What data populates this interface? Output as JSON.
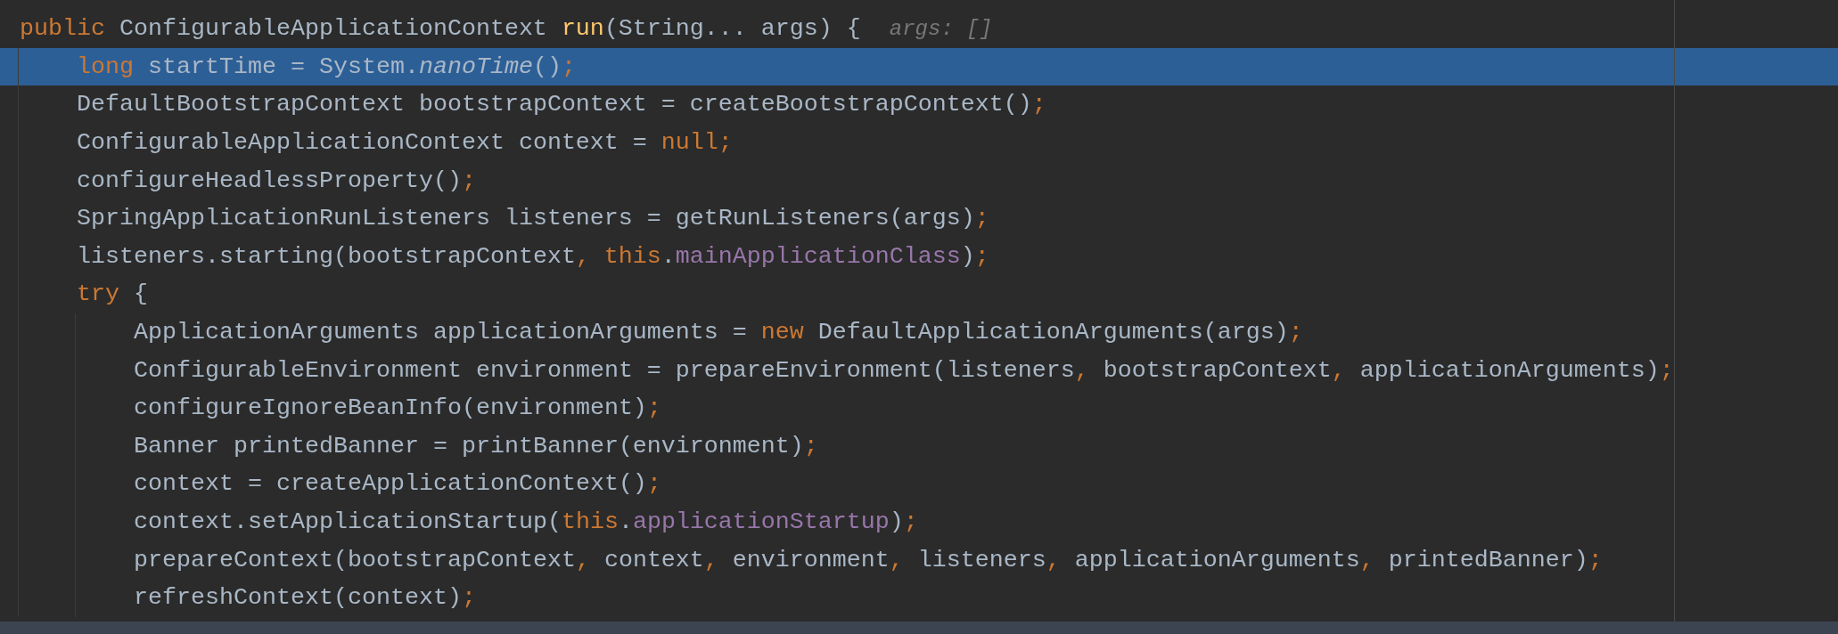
{
  "editor": {
    "lines": [
      {
        "selected": false,
        "tokens": [
          {
            "kind": "keyword",
            "text": "public"
          },
          {
            "kind": "plain",
            "text": " ConfigurableApplicationContext "
          },
          {
            "kind": "declaration",
            "text": "run"
          },
          {
            "kind": "plain",
            "text": "(String... args) {"
          }
        ],
        "hint": "args: []",
        "children": [
          {
            "selected": true,
            "tokens": [
              {
                "kind": "keyword",
                "text": "long"
              },
              {
                "kind": "plain",
                "text": " startTime = System."
              },
              {
                "kind": "static",
                "text": "nanoTime"
              },
              {
                "kind": "plain",
                "text": "()"
              },
              {
                "kind": "punct",
                "text": ";"
              }
            ]
          },
          {
            "selected": false,
            "tokens": [
              {
                "kind": "plain",
                "text": "DefaultBootstrapContext bootstrapContext = createBootstrapContext()"
              },
              {
                "kind": "punct",
                "text": ";"
              }
            ]
          },
          {
            "selected": false,
            "tokens": [
              {
                "kind": "plain",
                "text": "ConfigurableApplicationContext context = "
              },
              {
                "kind": "keyword",
                "text": "null"
              },
              {
                "kind": "punct",
                "text": ";"
              }
            ]
          },
          {
            "selected": false,
            "tokens": [
              {
                "kind": "plain",
                "text": "configureHeadlessProperty()"
              },
              {
                "kind": "punct",
                "text": ";"
              }
            ]
          },
          {
            "selected": false,
            "tokens": [
              {
                "kind": "plain",
                "text": "SpringApplicationRunListeners listeners = getRunListeners(args)"
              },
              {
                "kind": "punct",
                "text": ";"
              }
            ]
          },
          {
            "selected": false,
            "tokens": [
              {
                "kind": "plain",
                "text": "listeners.starting(bootstrapContext"
              },
              {
                "kind": "punct",
                "text": ","
              },
              {
                "kind": "keyword",
                "text": " this"
              },
              {
                "kind": "plain",
                "text": "."
              },
              {
                "kind": "field",
                "text": "mainApplicationClass"
              },
              {
                "kind": "plain",
                "text": ")"
              },
              {
                "kind": "punct",
                "text": ";"
              }
            ]
          },
          {
            "selected": false,
            "tokens": [
              {
                "kind": "keyword",
                "text": "try"
              },
              {
                "kind": "plain",
                "text": " {"
              }
            ],
            "children": [
              {
                "selected": false,
                "tokens": [
                  {
                    "kind": "plain",
                    "text": "ApplicationArguments applicationArguments = "
                  },
                  {
                    "kind": "keyword",
                    "text": "new"
                  },
                  {
                    "kind": "plain",
                    "text": " DefaultApplicationArguments(args)"
                  },
                  {
                    "kind": "punct",
                    "text": ";"
                  }
                ]
              },
              {
                "selected": false,
                "tokens": [
                  {
                    "kind": "plain",
                    "text": "ConfigurableEnvironment environment = prepareEnvironment(listeners"
                  },
                  {
                    "kind": "punct",
                    "text": ","
                  },
                  {
                    "kind": "plain",
                    "text": " bootstrapContext"
                  },
                  {
                    "kind": "punct",
                    "text": ","
                  },
                  {
                    "kind": "plain",
                    "text": " applicationArguments)"
                  },
                  {
                    "kind": "punct",
                    "text": ";"
                  }
                ]
              },
              {
                "selected": false,
                "tokens": [
                  {
                    "kind": "plain",
                    "text": "configureIgnoreBeanInfo(environment)"
                  },
                  {
                    "kind": "punct",
                    "text": ";"
                  }
                ]
              },
              {
                "selected": false,
                "tokens": [
                  {
                    "kind": "plain",
                    "text": "Banner printedBanner = printBanner(environment)"
                  },
                  {
                    "kind": "punct",
                    "text": ";"
                  }
                ]
              },
              {
                "selected": false,
                "tokens": [
                  {
                    "kind": "plain",
                    "text": "context = createApplicationContext()"
                  },
                  {
                    "kind": "punct",
                    "text": ";"
                  }
                ]
              },
              {
                "selected": false,
                "tokens": [
                  {
                    "kind": "plain",
                    "text": "context.setApplicationStartup("
                  },
                  {
                    "kind": "keyword",
                    "text": "this"
                  },
                  {
                    "kind": "plain",
                    "text": "."
                  },
                  {
                    "kind": "field",
                    "text": "applicationStartup"
                  },
                  {
                    "kind": "plain",
                    "text": ")"
                  },
                  {
                    "kind": "punct",
                    "text": ";"
                  }
                ]
              },
              {
                "selected": false,
                "tokens": [
                  {
                    "kind": "plain",
                    "text": "prepareContext(bootstrapContext"
                  },
                  {
                    "kind": "punct",
                    "text": ","
                  },
                  {
                    "kind": "plain",
                    "text": " context"
                  },
                  {
                    "kind": "punct",
                    "text": ","
                  },
                  {
                    "kind": "plain",
                    "text": " environment"
                  },
                  {
                    "kind": "punct",
                    "text": ","
                  },
                  {
                    "kind": "plain",
                    "text": " listeners"
                  },
                  {
                    "kind": "punct",
                    "text": ","
                  },
                  {
                    "kind": "plain",
                    "text": " applicationArguments"
                  },
                  {
                    "kind": "punct",
                    "text": ","
                  },
                  {
                    "kind": "plain",
                    "text": " printedBanner)"
                  },
                  {
                    "kind": "punct",
                    "text": ";"
                  }
                ]
              },
              {
                "selected": false,
                "tokens": [
                  {
                    "kind": "plain",
                    "text": "refreshContext(context)"
                  },
                  {
                    "kind": "punct",
                    "text": ";"
                  }
                ]
              }
            ]
          }
        ]
      }
    ]
  }
}
